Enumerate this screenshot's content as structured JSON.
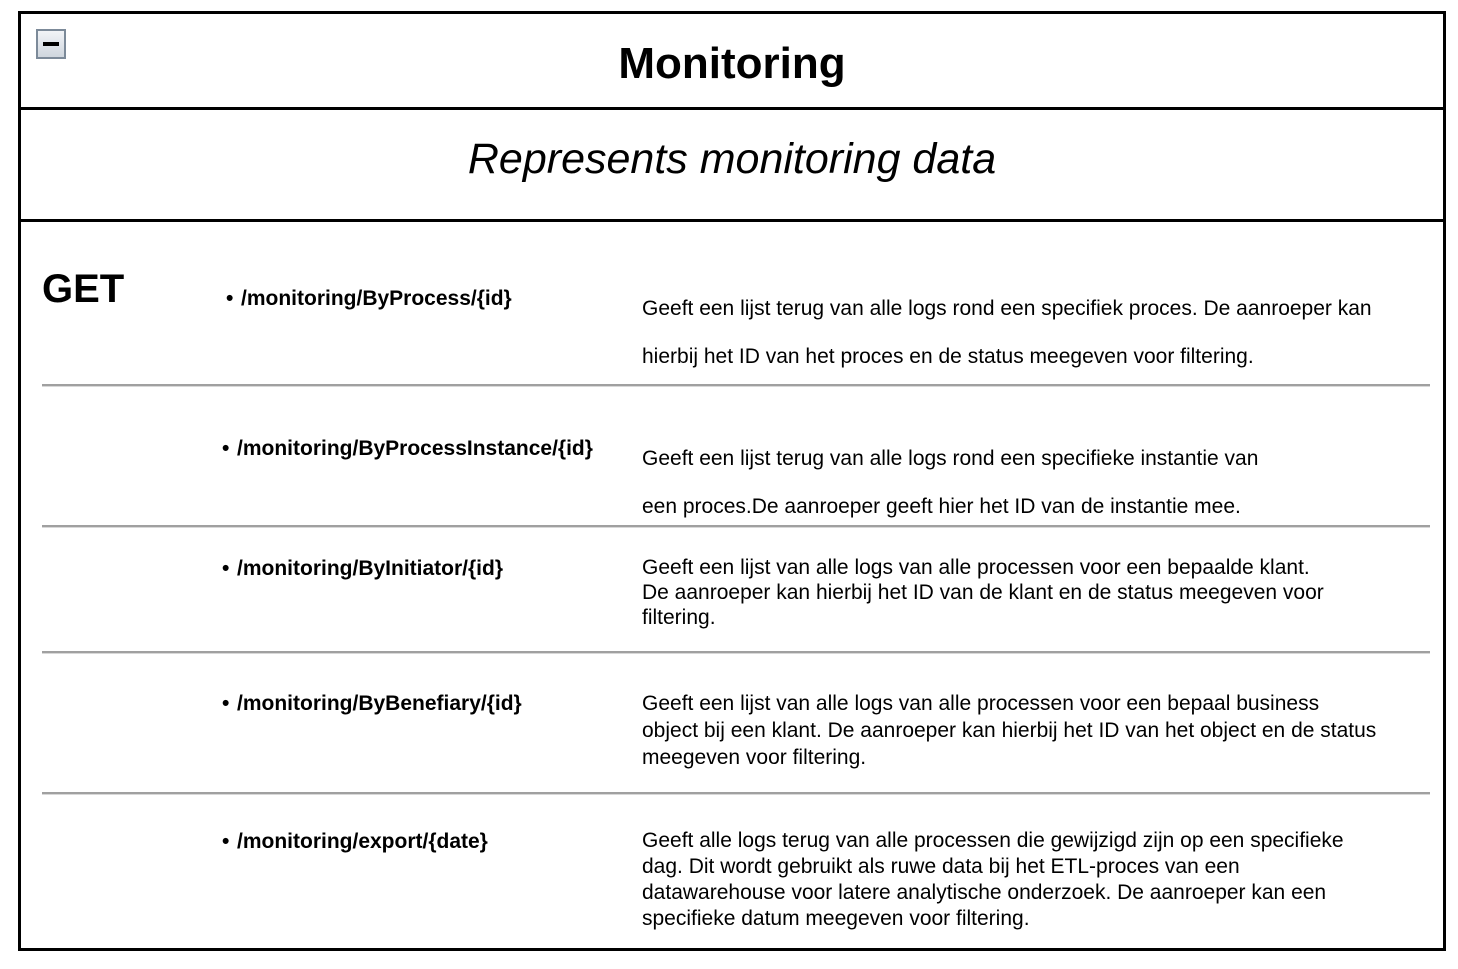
{
  "header": {
    "title": "Monitoring",
    "collapse_icon": "minus-box-icon"
  },
  "subtitle": "Represents monitoring data",
  "method": "GET",
  "endpoints": [
    {
      "path": "/monitoring/ByProcess/{id}",
      "description": [
        "Geeft een lijst terug van alle logs rond een specifiek proces. De aanroeper kan",
        "hierbij het ID van het proces en de status meegeven voor filtering."
      ]
    },
    {
      "path": "/monitoring/ByProcessInstance/{id}",
      "description": [
        "Geeft een lijst terug van alle logs rond een specifieke instantie van",
        "een proces.De aanroeper geeft hier het ID van de instantie mee."
      ]
    },
    {
      "path": "/monitoring/ByInitiator/{id}",
      "description": [
        "Geeft een lijst van alle logs van alle processen voor een bepaalde klant.",
        "De aanroeper kan hierbij het ID van de klant en de status meegeven voor",
        "filtering."
      ]
    },
    {
      "path": "/monitoring/ByBenefiary/{id}",
      "description": [
        "Geeft een lijst van alle logs van alle processen voor een bepaal business",
        "object bij een klant. De aanroeper kan hierbij het ID van het object en de status",
        "meegeven voor filtering."
      ]
    },
    {
      "path": "/monitoring/export/{date}",
      "description": [
        "Geeft alle logs terug van alle processen die gewijzigd zijn op een specifieke",
        "dag. Dit wordt gebruikt als ruwe data bij het ETL-proces van een",
        "datawarehouse voor latere analytische onderzoek. De aanroeper kan een",
        "specifieke datum meegeven voor filtering."
      ]
    }
  ]
}
